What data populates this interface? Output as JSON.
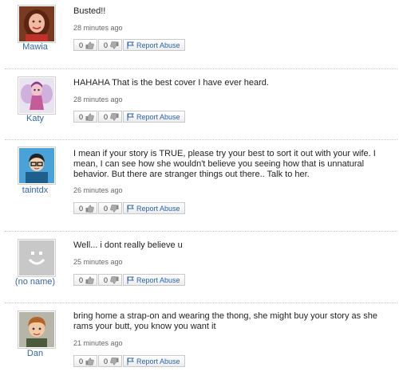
{
  "comments": [
    {
      "username": "Mawia",
      "avatar_icon": "woman-photo-avatar",
      "text": "Busted!!",
      "time": "28 minutes ago",
      "likes": "0",
      "dislikes": "0",
      "report_label": "Report Abuse"
    },
    {
      "username": "Katy",
      "avatar_icon": "fairy-avatar",
      "text": "HAHAHA That is the best cover I have ever heard.",
      "time": "28 minutes ago",
      "likes": "0",
      "dislikes": "0",
      "report_label": "Report Abuse"
    },
    {
      "username": "taintdx",
      "avatar_icon": "cartoon-glasses-avatar",
      "text": "I mean if your story is TRUE, please try your best to sort it out with your wife. I mean, I can see how she wouldn't believe you seeing how that is unnatural behavior. But there are stranger things out there.. Talk to her.",
      "time": "26 minutes ago",
      "likes": "0",
      "dislikes": "0",
      "report_label": "Report Abuse"
    },
    {
      "username": "(no name)",
      "avatar_icon": "default-smiley-avatar",
      "text": "Well... i dont really believe u",
      "time": "25 minutes ago",
      "likes": "0",
      "dislikes": "0",
      "report_label": "Report Abuse"
    },
    {
      "username": "Dan",
      "avatar_icon": "cartoon-boy-avatar",
      "text": "bring home a strap-on and wearing the thong, she might buy your story as she rams your butt, you know you want it",
      "time": "21 minutes ago",
      "likes": "0",
      "dislikes": "0",
      "report_label": "Report Abuse"
    }
  ],
  "colors": {
    "username": "#3366aa",
    "report_link": "#2a63b0",
    "text": "#222222",
    "timestamp": "#666666"
  }
}
